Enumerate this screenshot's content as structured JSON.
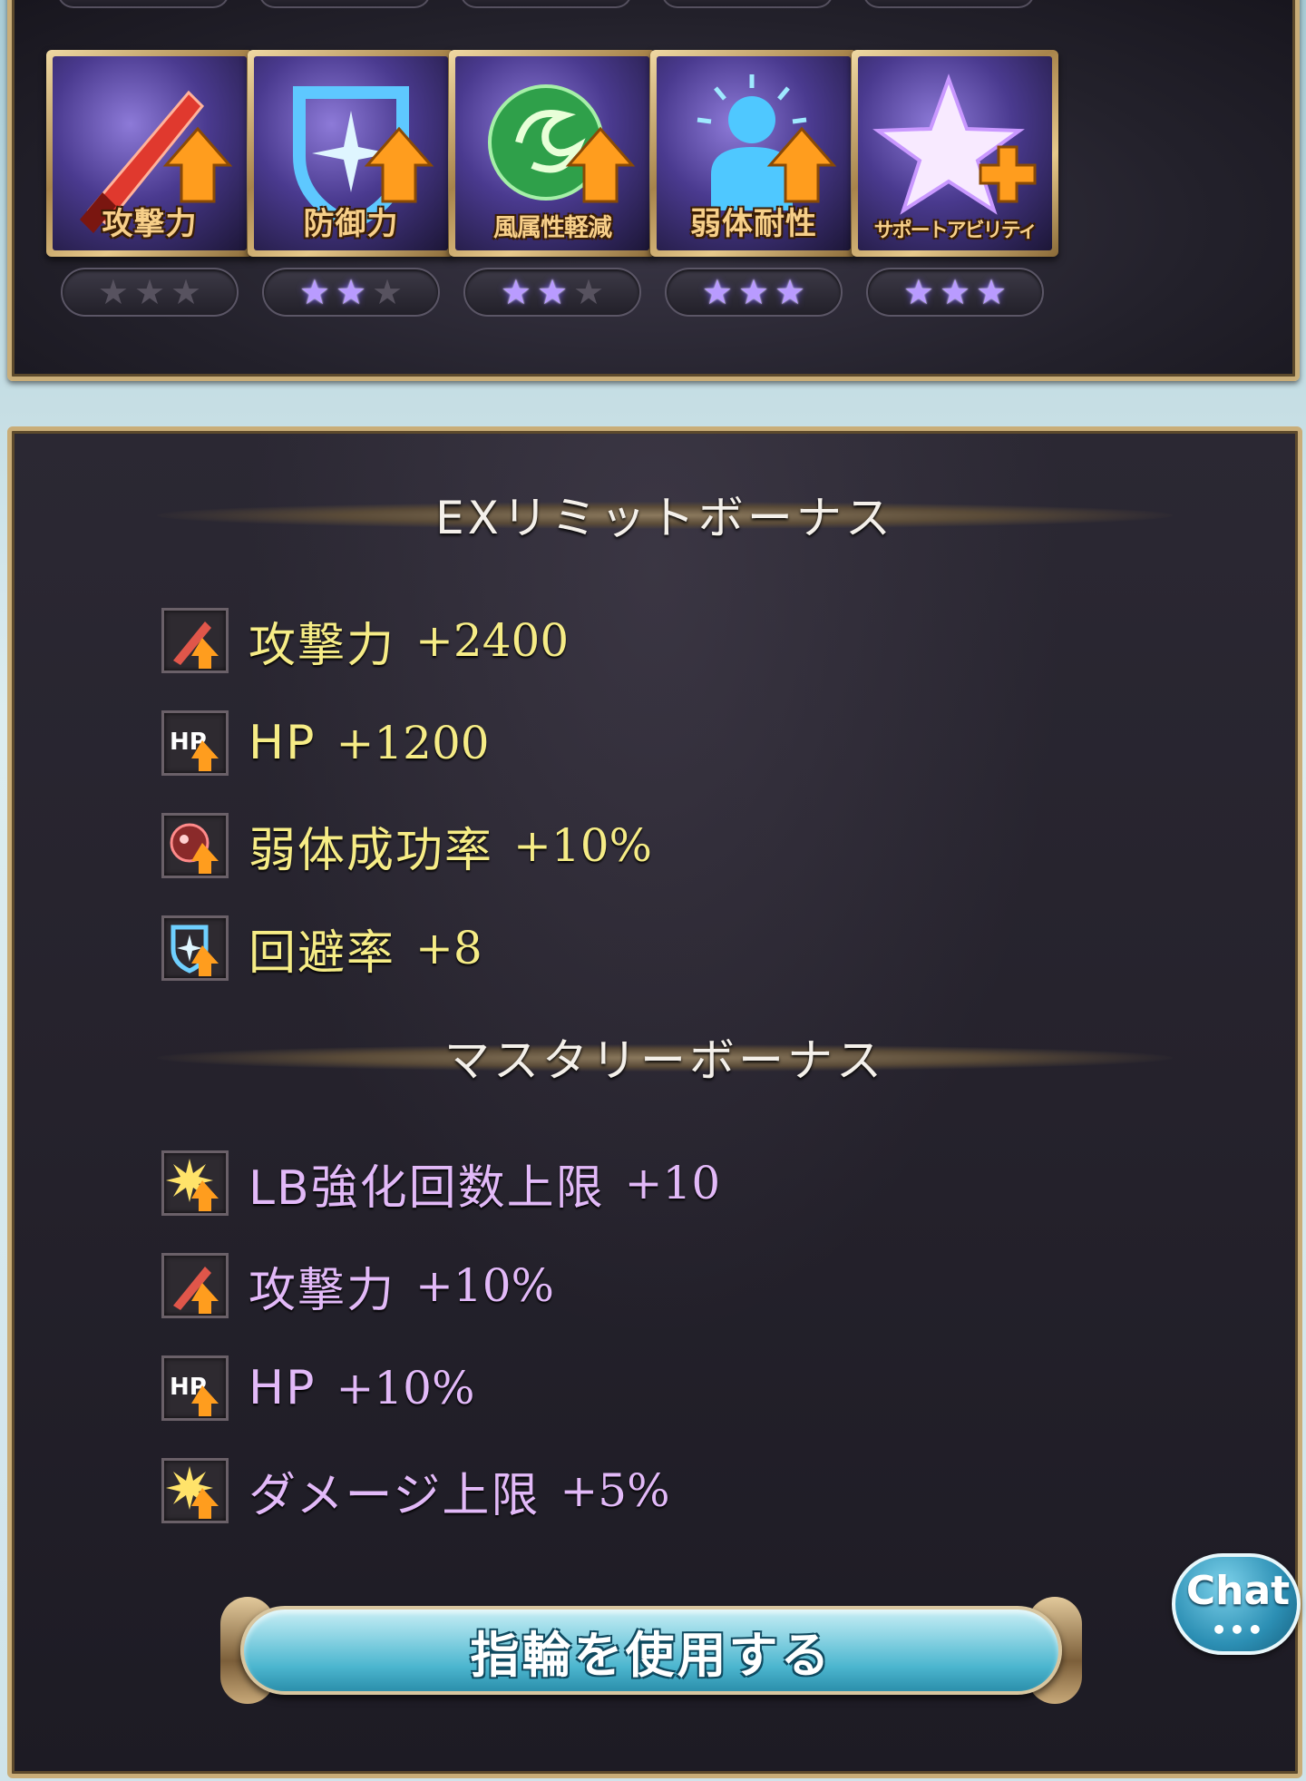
{
  "top_partial_stars": [
    "★★★",
    "★★★",
    "★★★",
    "★★★",
    "★★★"
  ],
  "skills": [
    {
      "name": "攻撃力",
      "stars_on": 0,
      "stars_total": 3
    },
    {
      "name": "防御力",
      "stars_on": 2,
      "stars_total": 3
    },
    {
      "name": "風属性軽減",
      "stars_on": 2,
      "stars_total": 3
    },
    {
      "name": "弱体耐性",
      "stars_on": 3,
      "stars_total": 3
    },
    {
      "name": "サポートアビリティ",
      "stars_on": 3,
      "stars_total": 3
    }
  ],
  "ex_limit": {
    "title": "EXリミットボーナス",
    "items": [
      {
        "name": "攻撃力",
        "value": "+2400",
        "icon": "sword-up-icon"
      },
      {
        "name": "HP",
        "value": "+1200",
        "icon": "hp-up-icon"
      },
      {
        "name": "弱体成功率",
        "value": "+10%",
        "icon": "debuff-rate-up-icon"
      },
      {
        "name": "回避率",
        "value": "+8",
        "icon": "evasion-up-icon"
      }
    ]
  },
  "mastery": {
    "title": "マスタリーボーナス",
    "items": [
      {
        "name": "LB強化回数上限",
        "value": "+10",
        "icon": "burst-up-icon"
      },
      {
        "name": "攻撃力",
        "value": "+10%",
        "icon": "sword-up-icon"
      },
      {
        "name": "HP",
        "value": "+10%",
        "icon": "hp-up-icon"
      },
      {
        "name": "ダメージ上限",
        "value": "+5%",
        "icon": "burst-up-icon"
      }
    ]
  },
  "button": {
    "label": "指輪を使用する"
  },
  "chat": {
    "label": "Chat",
    "dots": "•••"
  },
  "colors": {
    "ex_text": "#f6ec86",
    "mastery_text": "#e2b9f8",
    "star_on": "#b99bff",
    "frame_gold": "#c9ad78"
  }
}
